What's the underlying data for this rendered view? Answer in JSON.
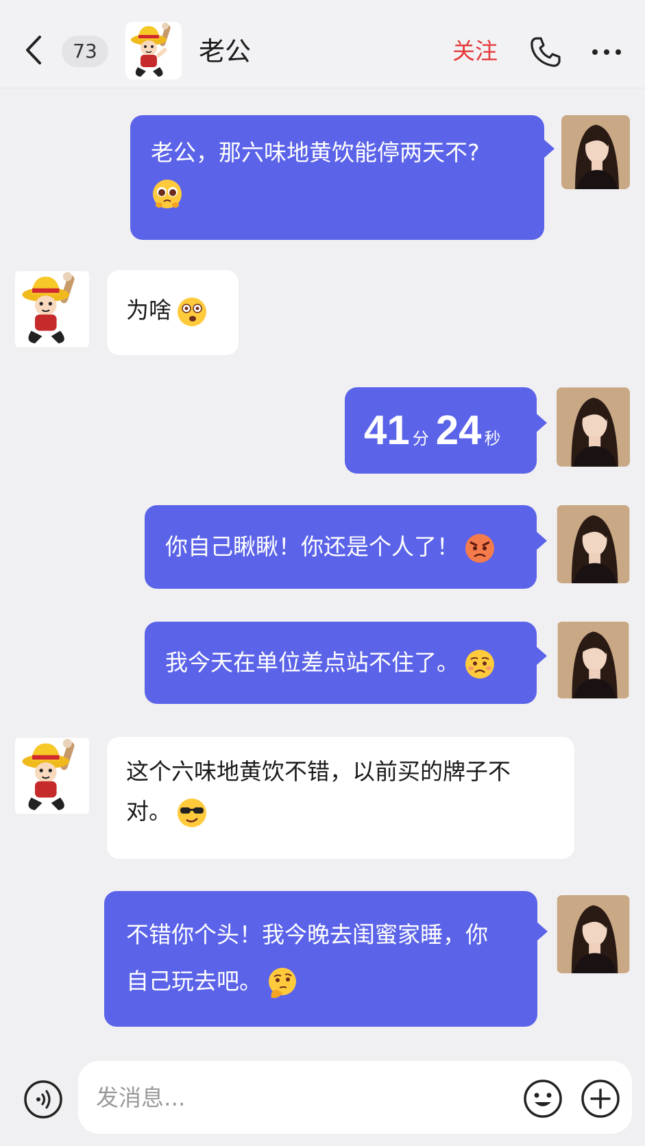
{
  "header": {
    "unread_count": "73",
    "contact_name": "老公",
    "follow_label": "关注"
  },
  "messages": [
    {
      "side": "out",
      "text": "老公，那六味地黄饮能停两天不?",
      "emoji": "pleading-face"
    },
    {
      "side": "in",
      "text": "为啥",
      "emoji": "surprised-face"
    },
    {
      "side": "out",
      "timer": {
        "minutes": "41",
        "min_unit": "分",
        "seconds": "24",
        "sec_unit": "秒"
      }
    },
    {
      "side": "out",
      "text": "你自己瞅瞅！你还是个人了！",
      "emoji": "angry-face"
    },
    {
      "side": "out",
      "text": "我今天在单位差点站不住了。",
      "emoji": "sad-face"
    },
    {
      "side": "in",
      "line1": "这个六味地黄饮不错，以前买的牌子不",
      "line2": "对。",
      "emoji": "sunglasses-face"
    },
    {
      "side": "out",
      "line1": "不错你个头！我今晚去闺蜜家睡，你",
      "line2": "自己玩去吧。",
      "emoji": "thinking-face"
    }
  ],
  "input": {
    "placeholder": "发消息..."
  },
  "colors": {
    "outgoing_bubble": "#5b63e8",
    "incoming_bubble": "#ffffff",
    "follow": "#e53b3b",
    "background": "#f0f0f2"
  }
}
